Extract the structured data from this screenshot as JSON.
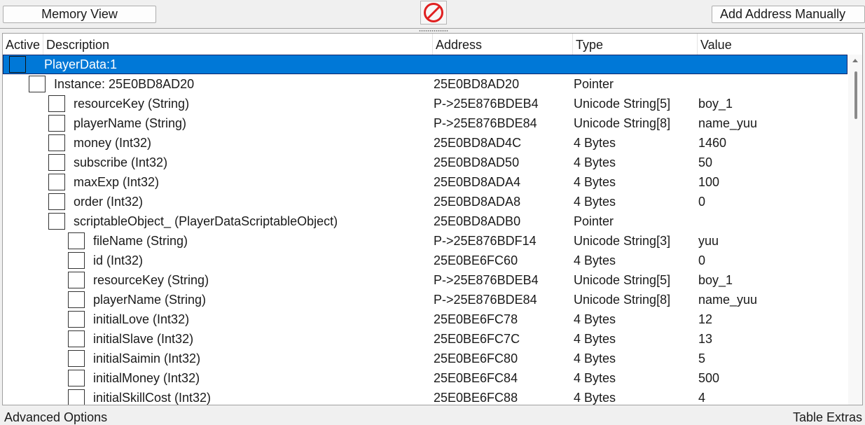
{
  "toolbar": {
    "memory_view_label": "Memory View",
    "add_address_label": "Add Address Manually",
    "stop_icon": "no-entry-icon",
    "stop_color": "#e02020"
  },
  "columns": {
    "active": "Active",
    "description": "Description",
    "address": "Address",
    "type": "Type",
    "value": "Value"
  },
  "rows": [
    {
      "description": "PlayerData:1",
      "address": "",
      "type": "",
      "value": "",
      "depth": 0,
      "selected": true
    },
    {
      "description": "Instance: 25E0BD8AD20",
      "address": "25E0BD8AD20",
      "type": "Pointer",
      "value": "",
      "depth": 1
    },
    {
      "description": "resourceKey (String)",
      "address": "P->25E876BDEB4",
      "type": "Unicode String[5]",
      "value": "boy_1",
      "depth": 2
    },
    {
      "description": "playerName (String)",
      "address": "P->25E876BDE84",
      "type": "Unicode String[8]",
      "value": "name_yuu",
      "depth": 2
    },
    {
      "description": "money (Int32)",
      "address": "25E0BD8AD4C",
      "type": "4 Bytes",
      "value": "1460",
      "depth": 2
    },
    {
      "description": "subscribe (Int32)",
      "address": "25E0BD8AD50",
      "type": "4 Bytes",
      "value": "50",
      "depth": 2
    },
    {
      "description": "maxExp (Int32)",
      "address": "25E0BD8ADA4",
      "type": "4 Bytes",
      "value": "100",
      "depth": 2
    },
    {
      "description": "order (Int32)",
      "address": "25E0BD8ADA8",
      "type": "4 Bytes",
      "value": "0",
      "depth": 2
    },
    {
      "description": "scriptableObject_ (PlayerDataScriptableObject)",
      "address": "25E0BD8ADB0",
      "type": "Pointer",
      "value": "",
      "depth": 2
    },
    {
      "description": "fileName (String)",
      "address": "P->25E876BDF14",
      "type": "Unicode String[3]",
      "value": "yuu",
      "depth": 3
    },
    {
      "description": "id (Int32)",
      "address": "25E0BE6FC60",
      "type": "4 Bytes",
      "value": "0",
      "depth": 3
    },
    {
      "description": "resourceKey (String)",
      "address": "P->25E876BDEB4",
      "type": "Unicode String[5]",
      "value": "boy_1",
      "depth": 3
    },
    {
      "description": "playerName (String)",
      "address": "P->25E876BDE84",
      "type": "Unicode String[8]",
      "value": "name_yuu",
      "depth": 3
    },
    {
      "description": "initialLove (Int32)",
      "address": "25E0BE6FC78",
      "type": "4 Bytes",
      "value": "12",
      "depth": 3
    },
    {
      "description": "initialSlave (Int32)",
      "address": "25E0BE6FC7C",
      "type": "4 Bytes",
      "value": "13",
      "depth": 3
    },
    {
      "description": "initialSaimin (Int32)",
      "address": "25E0BE6FC80",
      "type": "4 Bytes",
      "value": "5",
      "depth": 3
    },
    {
      "description": "initialMoney (Int32)",
      "address": "25E0BE6FC84",
      "type": "4 Bytes",
      "value": "500",
      "depth": 3
    },
    {
      "description": "initialSkillCost (Int32)",
      "address": "25E0BE6FC88",
      "type": "4 Bytes",
      "value": "4",
      "depth": 3
    }
  ],
  "footer": {
    "advanced_label": "Advanced Options",
    "extras_label": "Table Extras"
  },
  "colors": {
    "selection": "#0078d7"
  }
}
